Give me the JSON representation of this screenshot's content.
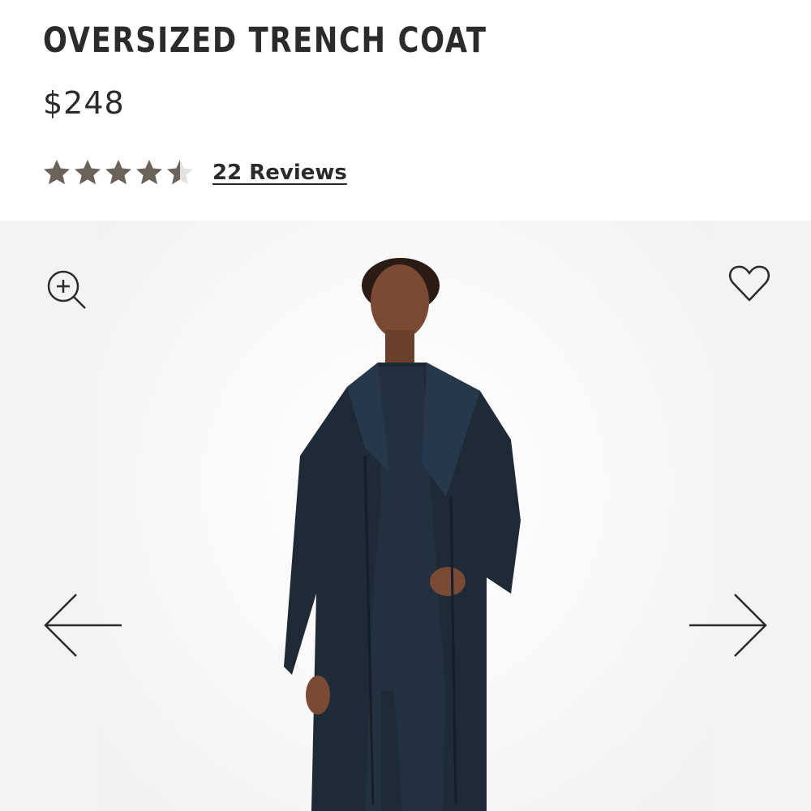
{
  "product": {
    "title": "OVERSIZED TRENCH COAT",
    "price": "$248",
    "rating": 4.5,
    "rating_max": 5,
    "reviews_label": "22 Reviews"
  },
  "colors": {
    "text": "#2b2b2b",
    "star_filled": "#6b625a",
    "star_empty": "#e2e2e2",
    "gallery_bg": "#f3f3f3",
    "coat": "#1e2a36",
    "skin": "#6e4430"
  },
  "gallery": {
    "icons": {
      "zoom": "zoom-in-icon",
      "favorite": "heart-icon",
      "previous": "arrow-left-icon",
      "next": "arrow-right-icon"
    }
  }
}
